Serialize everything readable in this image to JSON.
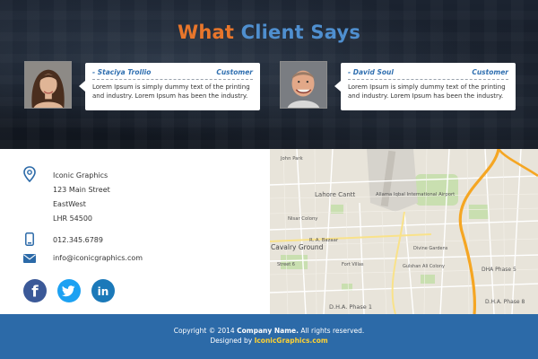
{
  "testimonials": {
    "title_part1": "What",
    "title_part2": "Client Says",
    "items": [
      {
        "name": "- Staciya Trollio",
        "role": "Customer",
        "text": "Lorem Ipsum is simply dummy text of the printing and industry. Lorem Ipsum has been the industry."
      },
      {
        "name": "- David Soul",
        "role": "Customer",
        "text": "Lorem Ipsum is simply dummy text of the printing and industry. Lorem Ipsum has been the industry."
      }
    ]
  },
  "contact": {
    "company": "Iconic Graphics",
    "address1": "123 Main Street",
    "address2": "EastWest",
    "address3": "LHR 54500",
    "phone": "012.345.6789",
    "email": "info@iconicgraphics.com",
    "icons": {
      "location": "map-pin-icon",
      "phone": "phone-icon",
      "email": "envelope-icon"
    },
    "social": {
      "facebook": "f",
      "twitter": "twitter",
      "linkedin": "in"
    }
  },
  "map": {
    "labels": {
      "lahore_cantt": "Lahore Cantt",
      "airport_en": "Allama Iqbal International Airport",
      "cavalry_ground": "Cavalry Ground",
      "nisar_colony": "Nisar Colony",
      "rb_bazaar": "R. A. Bazaar",
      "fort_villas": "Fort Villas",
      "gulshan_ali": "Gulshan Ali Colony",
      "dha_phase1": "D.H.A. Phase 1",
      "dha_phase5": "DHA Phase 5",
      "dha_phase8": "D.H.A. Phase 8",
      "divine_gardens": "Divine Gardens",
      "john_park": "John Park",
      "street6": "Street 6"
    }
  },
  "footer": {
    "copyright_prefix": "Copyright © 2014",
    "company_name": "Company Name.",
    "rights": "All rights reserved.",
    "designed_by": "Designed by",
    "designer": "IconicGraphics.com"
  },
  "colors": {
    "title_accent_orange": "#e8762b",
    "title_accent_blue": "#4f8fcf",
    "footer_bg": "#2c6aa8",
    "icon_blue": "#2c6aa8"
  }
}
